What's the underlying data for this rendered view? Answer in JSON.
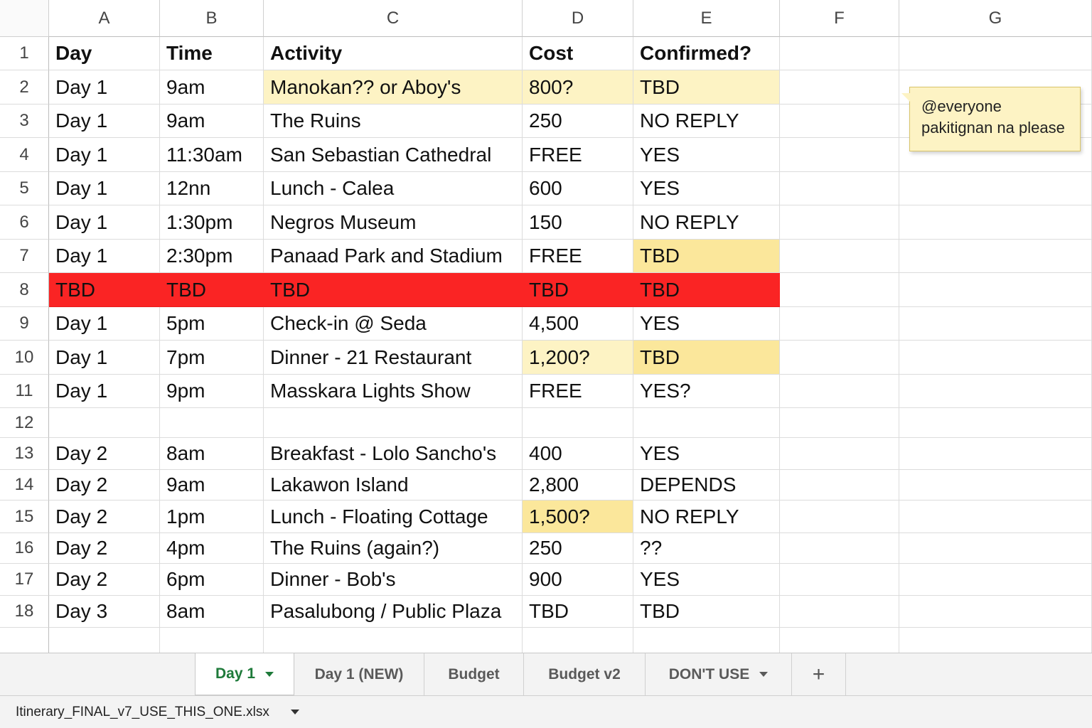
{
  "sheet": {
    "columns": [
      "A",
      "B",
      "C",
      "D",
      "E",
      "F",
      "G"
    ],
    "rows": [
      {
        "num": "1",
        "cells": [
          "Day",
          "Time",
          "Activity",
          "Cost",
          "Confirmed?",
          "",
          ""
        ],
        "bold": true
      },
      {
        "num": "2",
        "cells": [
          "Day 1",
          "9am",
          "Manokan?? or Aboy's",
          "800?",
          "TBD",
          "",
          ""
        ],
        "highlight": {
          "2": "yellow",
          "3": "yellow",
          "4": "yellow"
        }
      },
      {
        "num": "3",
        "cells": [
          "Day 1",
          "9am",
          "The Ruins",
          "250",
          "NO REPLY",
          "",
          ""
        ]
      },
      {
        "num": "4",
        "cells": [
          "Day 1",
          "11:30am",
          "San Sebastian Cathedral",
          "FREE",
          "YES",
          "",
          ""
        ]
      },
      {
        "num": "5",
        "cells": [
          "Day 1",
          "12nn",
          "Lunch - Calea",
          "600",
          "YES",
          "",
          ""
        ]
      },
      {
        "num": "6",
        "cells": [
          "Day 1",
          "1:30pm",
          "Negros Museum",
          "150",
          "NO REPLY",
          "",
          ""
        ]
      },
      {
        "num": "7",
        "cells": [
          "Day 1",
          "2:30pm",
          "Panaad Park and Stadium",
          "FREE",
          "TBD",
          "",
          ""
        ],
        "highlight": {
          "4": "yellow-strong"
        }
      },
      {
        "num": "8",
        "cells": [
          "TBD",
          "TBD",
          "TBD",
          "TBD",
          "TBD",
          "",
          ""
        ],
        "highlight": {
          "0": "red",
          "1": "red",
          "2": "red",
          "3": "red",
          "4": "red"
        }
      },
      {
        "num": "9",
        "cells": [
          "Day 1",
          "5pm",
          "Check-in @ Seda",
          "4,500",
          "YES",
          "",
          ""
        ]
      },
      {
        "num": "10",
        "cells": [
          "Day 1",
          "7pm",
          "Dinner - 21 Restaurant",
          "1,200?",
          "TBD",
          "",
          ""
        ],
        "highlight": {
          "3": "yellow",
          "4": "yellow-strong"
        }
      },
      {
        "num": "11",
        "cells": [
          "Day 1",
          "9pm",
          "Masskara Lights Show",
          "FREE",
          "YES?",
          "",
          ""
        ]
      },
      {
        "num": "12",
        "cells": [
          "",
          "",
          "",
          "",
          "",
          "",
          ""
        ]
      },
      {
        "num": "13",
        "cells": [
          "Day 2",
          "8am",
          "Breakfast - Lolo Sancho's",
          "400",
          "YES",
          "",
          ""
        ]
      },
      {
        "num": "14",
        "cells": [
          "Day 2",
          "9am",
          "Lakawon Island",
          "2,800",
          "DEPENDS",
          "",
          ""
        ]
      },
      {
        "num": "15",
        "cells": [
          "Day 2",
          "1pm",
          "Lunch - Floating Cottage",
          "1,500?",
          "NO REPLY",
          "",
          ""
        ],
        "highlight": {
          "3": "yellow-strong"
        }
      },
      {
        "num": "16",
        "cells": [
          "Day 2",
          "4pm",
          "The Ruins (again?)",
          "250",
          "??",
          "",
          ""
        ]
      },
      {
        "num": "17",
        "cells": [
          "Day 2",
          "6pm",
          "Dinner - Bob's",
          "900",
          "YES",
          "",
          ""
        ]
      },
      {
        "num": "18",
        "cells": [
          "Day 3",
          "8am",
          "Pasalubong / Public Plaza",
          "TBD",
          "TBD",
          "",
          ""
        ]
      },
      {
        "num": "",
        "cells": [
          "",
          "",
          "",
          "",
          "",
          "",
          ""
        ]
      }
    ]
  },
  "comment": {
    "text": "@everyone pakitignan na please"
  },
  "tabs": [
    {
      "label": "Day 1",
      "active": true,
      "dropdown": true
    },
    {
      "label": "Day 1 (NEW)",
      "active": false,
      "dropdown": false
    },
    {
      "label": "Budget",
      "active": false,
      "dropdown": false
    },
    {
      "label": "Budget v2",
      "active": false,
      "dropdown": false
    },
    {
      "label": "DON'T USE",
      "active": false,
      "dropdown": true
    }
  ],
  "add_tab_icon": "plus-icon",
  "file": {
    "name": "Itinerary_FINAL_v7_USE_THIS_ONE.xlsx"
  },
  "colors": {
    "yellow": "#fdf3c4",
    "yellow_strong": "#fbe79b",
    "red": "#fa2424",
    "active_tab_text": "#1e7a3a"
  }
}
